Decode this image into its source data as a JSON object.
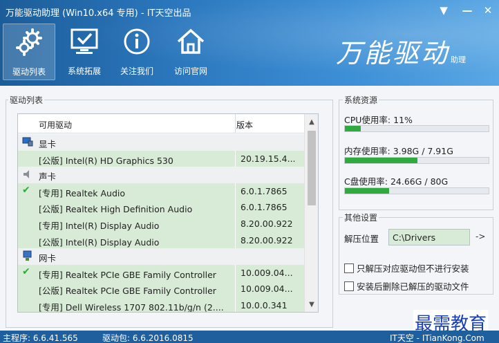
{
  "window": {
    "title": "万能驱动助理 (Win10.x64 专用) - IT天空出品"
  },
  "toolbar": {
    "items": [
      {
        "label": "驱动列表",
        "icon": "gears-icon",
        "active": true
      },
      {
        "label": "系统拓展",
        "icon": "monitor-check-icon",
        "active": false
      },
      {
        "label": "关注我们",
        "icon": "info-icon",
        "active": false
      },
      {
        "label": "访问官网",
        "icon": "home-icon",
        "active": false
      }
    ]
  },
  "brand": {
    "main": "万能驱动",
    "sub": "助理"
  },
  "driver_list": {
    "title": "驱动列表",
    "columns": [
      "可用驱动",
      "版本"
    ],
    "rows": [
      {
        "type": "category",
        "icon": "display-icon",
        "name": "显卡",
        "version": ""
      },
      {
        "type": "item",
        "checked": false,
        "name": "[公版] Intel(R) HD Graphics 530",
        "version": "20.19.15.4..."
      },
      {
        "type": "category",
        "icon": "speaker-icon",
        "name": "声卡",
        "version": ""
      },
      {
        "type": "item",
        "checked": true,
        "name": "[专用] Realtek Audio",
        "version": "6.0.1.7865"
      },
      {
        "type": "item",
        "checked": false,
        "name": "[公版] Realtek High Definition Audio",
        "version": "6.0.1.7865"
      },
      {
        "type": "item",
        "checked": false,
        "name": "[专用] Intel(R) Display Audio",
        "version": "8.20.00.922"
      },
      {
        "type": "item",
        "checked": false,
        "name": "[公版] Intel(R) Display Audio",
        "version": "8.20.00.922"
      },
      {
        "type": "category",
        "icon": "network-icon",
        "name": "网卡",
        "version": ""
      },
      {
        "type": "item",
        "checked": true,
        "name": "[专用] Realtek PCIe GBE Family Controller",
        "version": "10.009.04..."
      },
      {
        "type": "item",
        "checked": false,
        "name": "[公版] Realtek PCIe GBE Family Controller",
        "version": "10.009.04..."
      },
      {
        "type": "item",
        "checked": false,
        "name": "[专用] Dell Wireless 1707 802.11b/g/n (2....",
        "version": "10.0.0.341"
      }
    ]
  },
  "resources": {
    "title": "系统资源",
    "cpu": {
      "label": "CPU使用率:",
      "value": "11%",
      "fraction": 0.11
    },
    "memory": {
      "label": "内存使用率:",
      "value": "3.98G / 7.91G",
      "fraction": 0.503
    },
    "disk": {
      "label": "C盘使用率:",
      "value": "24.66G / 80G",
      "fraction": 0.308
    }
  },
  "settings": {
    "title": "其他设置",
    "path_label": "解压位置",
    "path_value": "C:\\Drivers",
    "browse_label": "->",
    "option1": "只解压对应驱动但不进行安装",
    "option2": "安装后删除已解压的驱动文件"
  },
  "watermark": "最需教育",
  "status": {
    "main_version": "主程序: 6.6.41.565",
    "package_version": "驱动包: 6.6.2016.0815",
    "right": "IT天空 - ITianKong.Com"
  }
}
